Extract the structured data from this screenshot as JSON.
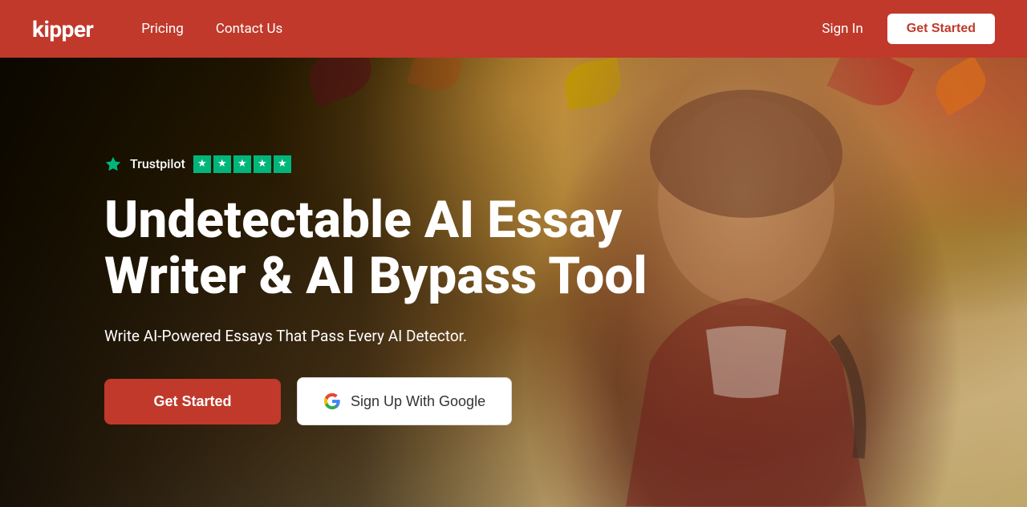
{
  "brand": {
    "logo": "kipper"
  },
  "navbar": {
    "links": [
      {
        "label": "Pricing",
        "href": "#"
      },
      {
        "label": "Contact Us",
        "href": "#"
      }
    ],
    "signin_label": "Sign In",
    "get_started_label": "Get Started"
  },
  "hero": {
    "trustpilot": {
      "name": "Trustpilot",
      "stars": 5
    },
    "heading": "Undetectable AI Essay Writer & AI Bypass Tool",
    "subtext": "Write AI-Powered Essays That Pass Every AI Detector.",
    "cta_primary": "Get Started",
    "cta_google": "Sign Up With Google"
  },
  "colors": {
    "brand_red": "#c0392b",
    "white": "#ffffff",
    "dark": "#1a1a1a",
    "google_blue": "#4285F4",
    "google_red": "#EA4335",
    "google_yellow": "#FBBC05",
    "google_green": "#34A853",
    "trustpilot_green": "#00b67a"
  }
}
